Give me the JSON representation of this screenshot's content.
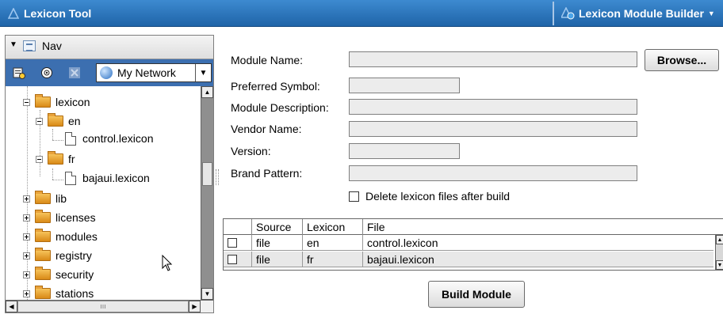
{
  "titlebar": {
    "app_title": "Lexicon Tool",
    "view_title": "Lexicon Module Builder",
    "view_menu_icon": "chevron-down-icon"
  },
  "nav": {
    "header_label": "Nav",
    "network_value": "My Network",
    "tree": [
      {
        "label": "lexicon",
        "type": "folder",
        "expanded": true
      },
      {
        "label": "en",
        "type": "folder",
        "expanded": true
      },
      {
        "label": "control.lexicon",
        "type": "file"
      },
      {
        "label": "fr",
        "type": "folder",
        "expanded": true
      },
      {
        "label": "bajaui.lexicon",
        "type": "file"
      },
      {
        "label": "lib",
        "type": "folder",
        "expanded": false
      },
      {
        "label": "licenses",
        "type": "folder",
        "expanded": false
      },
      {
        "label": "modules",
        "type": "folder",
        "expanded": false
      },
      {
        "label": "registry",
        "type": "folder",
        "expanded": false
      },
      {
        "label": "security",
        "type": "folder",
        "expanded": false
      },
      {
        "label": "stations",
        "type": "folder",
        "expanded": false
      }
    ]
  },
  "form": {
    "module_name_label": "Module Name:",
    "preferred_symbol_label": "Preferred Symbol:",
    "module_description_label": "Module Description:",
    "vendor_name_label": "Vendor Name:",
    "version_label": "Version:",
    "brand_pattern_label": "Brand Pattern:",
    "browse_label": "Browse...",
    "delete_checkbox_label": "Delete lexicon files after build",
    "module_name": "",
    "preferred_symbol": "",
    "module_description": "",
    "vendor_name": "",
    "version": "",
    "brand_pattern": ""
  },
  "table": {
    "columns": [
      "Source",
      "Lexicon",
      "File"
    ],
    "rows": [
      {
        "source": "file",
        "lexicon": "en",
        "file": "control.lexicon"
      },
      {
        "source": "file",
        "lexicon": "fr",
        "file": "bajaui.lexicon"
      }
    ]
  },
  "build_label": "Build Module",
  "colors": {
    "titlebar": "#2a74bd",
    "nav_toolbar": "#3c6fb0",
    "folder": "#e8a23a"
  }
}
